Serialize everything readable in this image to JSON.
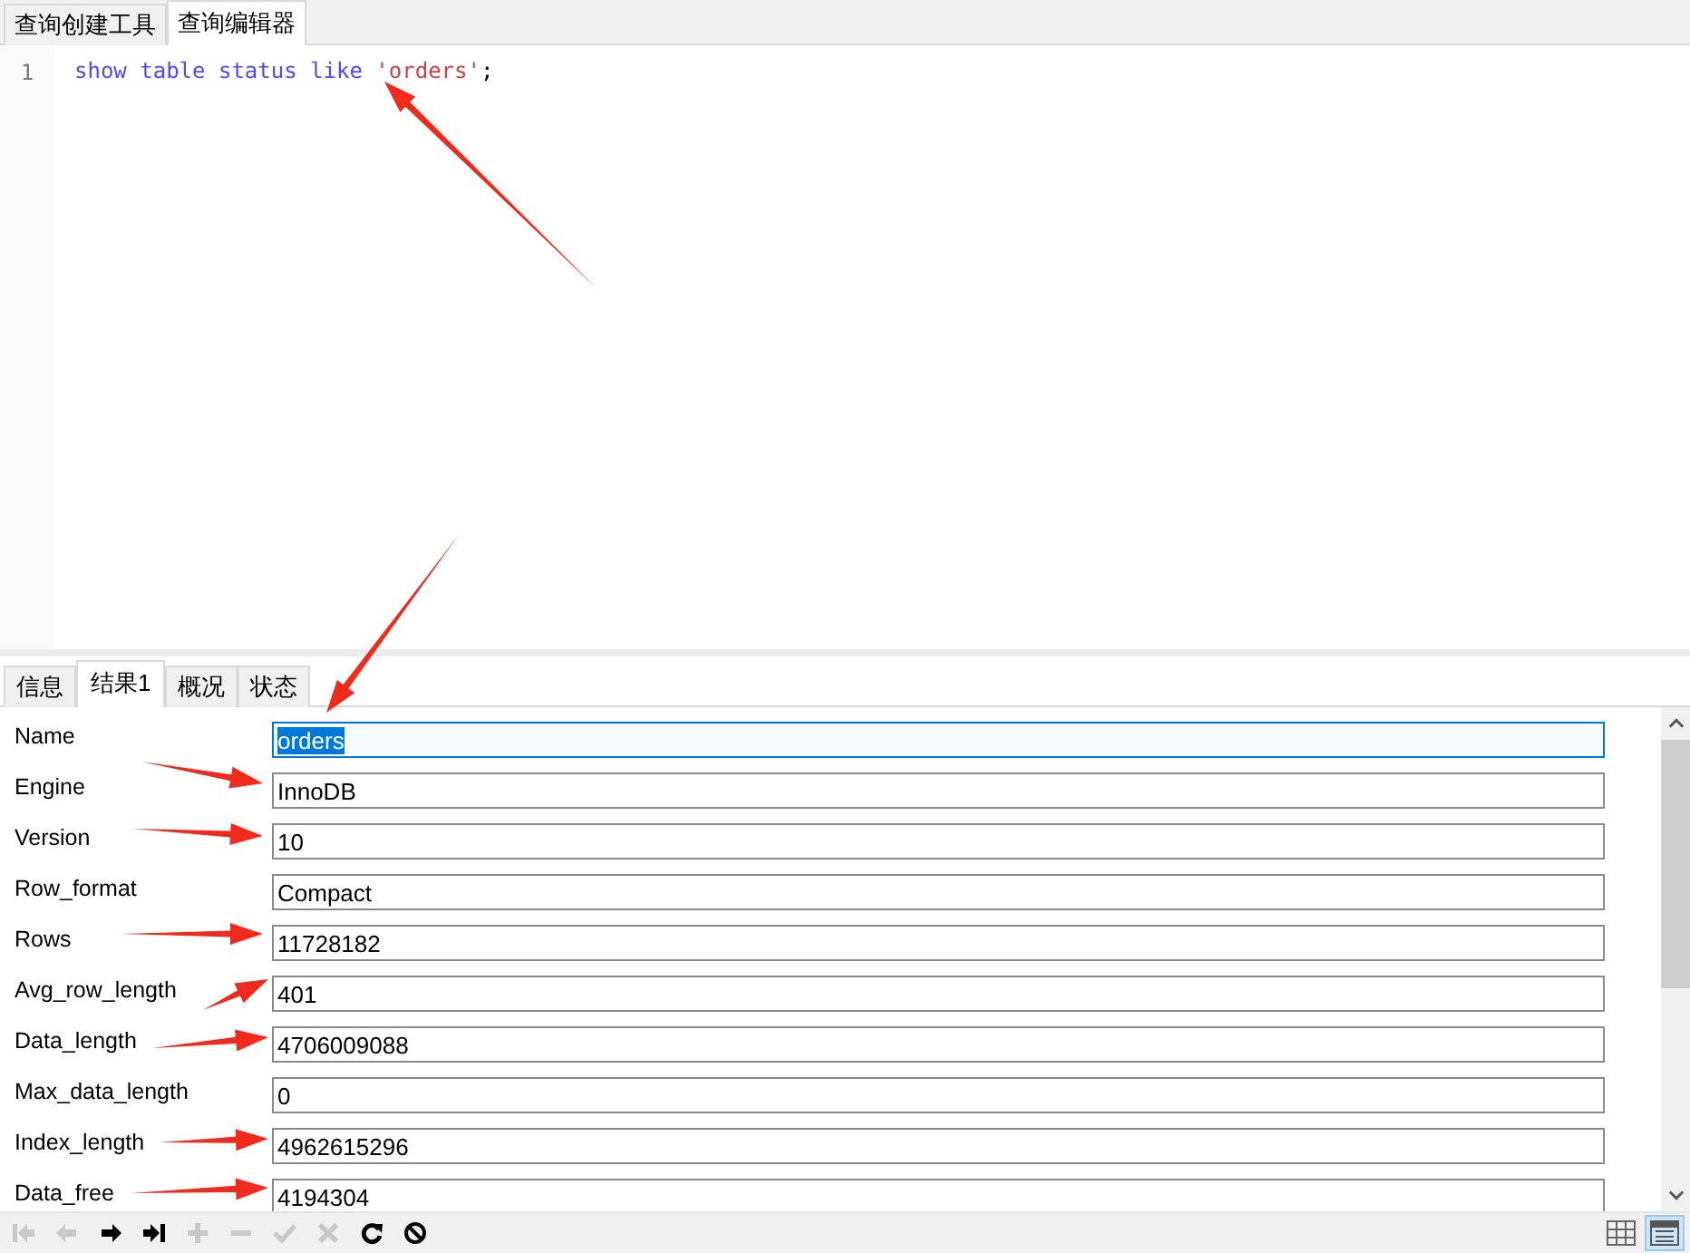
{
  "editor_tabs": [
    {
      "label": "查询创建工具",
      "selected": false
    },
    {
      "label": "查询编辑器",
      "selected": true
    }
  ],
  "editor": {
    "line_number": "1",
    "tokens": [
      {
        "text": "show",
        "kind": "keyword"
      },
      {
        "text": "table",
        "kind": "keyword"
      },
      {
        "text": "status",
        "kind": "keyword"
      },
      {
        "text": "like",
        "kind": "keyword"
      },
      {
        "text": "'orders'",
        "kind": "string"
      },
      {
        "text": ";",
        "kind": "punct"
      }
    ]
  },
  "result_tabs": [
    {
      "label": "信息",
      "selected": false
    },
    {
      "label": "结果1",
      "selected": true
    },
    {
      "label": "概况",
      "selected": false
    },
    {
      "label": "状态",
      "selected": false
    }
  ],
  "fields": [
    {
      "label": "Name",
      "value": "orders",
      "selected": true
    },
    {
      "label": "Engine",
      "value": "InnoDB",
      "selected": false
    },
    {
      "label": "Version",
      "value": "10",
      "selected": false
    },
    {
      "label": "Row_format",
      "value": "Compact",
      "selected": false
    },
    {
      "label": "Rows",
      "value": "11728182",
      "selected": false
    },
    {
      "label": "Avg_row_length",
      "value": "401",
      "selected": false
    },
    {
      "label": "Data_length",
      "value": "4706009088",
      "selected": false
    },
    {
      "label": "Max_data_length",
      "value": "0",
      "selected": false
    },
    {
      "label": "Index_length",
      "value": "4962615296",
      "selected": false
    },
    {
      "label": "Data_free",
      "value": "4194304",
      "selected": false
    }
  ],
  "toolbar": [
    {
      "kind": "first",
      "disabled": true
    },
    {
      "kind": "prev",
      "disabled": true
    },
    {
      "kind": "next",
      "disabled": false
    },
    {
      "kind": "last",
      "disabled": false
    },
    {
      "kind": "add",
      "disabled": true
    },
    {
      "kind": "remove",
      "disabled": true
    },
    {
      "kind": "apply",
      "disabled": true
    },
    {
      "kind": "discard",
      "disabled": true
    },
    {
      "kind": "refresh",
      "disabled": false
    },
    {
      "kind": "stop",
      "disabled": false
    }
  ],
  "view_buttons": [
    {
      "kind": "grid",
      "selected": false
    },
    {
      "kind": "form",
      "selected": true
    }
  ]
}
